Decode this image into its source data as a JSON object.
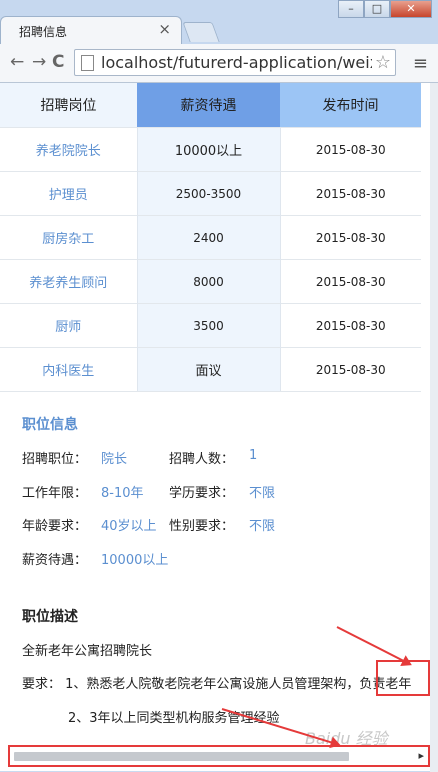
{
  "browser": {
    "tab_title": "招聘信息",
    "tab_close": "×",
    "url": "localhost/futurerd-application/weix",
    "back": "←",
    "forward": "→",
    "reload": "C",
    "star": "☆",
    "menu": "≡",
    "minimize": "–",
    "maximize": "□",
    "close": "✕"
  },
  "table": {
    "headers": [
      "招聘岗位",
      "薪资待遇",
      "发布时间"
    ],
    "rows": [
      {
        "position": "养老院院长",
        "salary": "10000以上",
        "date": "2015-08-30"
      },
      {
        "position": "护理员",
        "salary": "2500-3500",
        "date": "2015-08-30"
      },
      {
        "position": "厨房杂工",
        "salary": "2400",
        "date": "2015-08-30"
      },
      {
        "position": "养老养生顾问",
        "salary": "8000",
        "date": "2015-08-30"
      },
      {
        "position": "厨师",
        "salary": "3500",
        "date": "2015-08-30"
      },
      {
        "position": "内科医生",
        "salary": "面议",
        "date": "2015-08-30"
      }
    ]
  },
  "job_info": {
    "title": "职位信息",
    "position_label": "招聘职位：",
    "position_value": "院长",
    "count_label": "招聘人数：",
    "count_value": "1",
    "years_label": "工作年限：",
    "years_value": "8-10年",
    "edu_label": "学历要求：",
    "edu_value": "不限",
    "age_label": "年龄要求：",
    "age_value": "40岁以上",
    "gender_label": "性别要求：",
    "gender_value": "不限",
    "salary_label": "薪资待遇：",
    "salary_value": "10000以上"
  },
  "job_desc": {
    "title": "职位描述",
    "line1": "全新老年公寓招聘院长",
    "line2_prefix": "要求：  1、熟悉老人院敬老院老年公寓设施人员管理架构，",
    "line2_cut": "负责老年",
    "line3": "2、3年以上同类型机构服务管理经验"
  },
  "scrollbar": {
    "right_arrow": "▸"
  },
  "watermark": "Baidu 经验",
  "annotation_color": "#e53a3a"
}
